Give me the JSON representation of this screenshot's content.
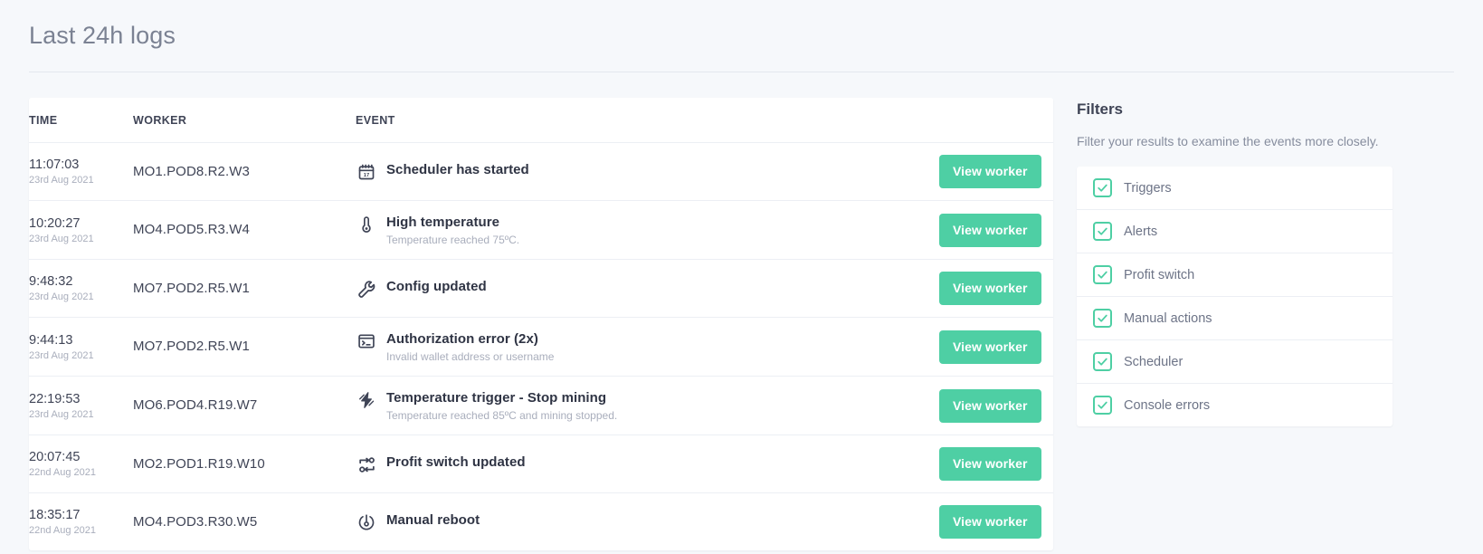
{
  "header": {
    "title": "Last 24h logs"
  },
  "table": {
    "columns": {
      "time": "TIME",
      "worker": "WORKER",
      "event": "EVENT",
      "action": ""
    },
    "action_label": "View worker",
    "rows": [
      {
        "time": "11:07:03",
        "date": "23rd Aug 2021",
        "worker": "MO1.POD8.R2.W3",
        "icon": "calendar-icon",
        "event_title": "Scheduler has started",
        "event_desc": ""
      },
      {
        "time": "10:20:27",
        "date": "23rd Aug 2021",
        "worker": "MO4.POD5.R3.W4",
        "icon": "thermometer-icon",
        "event_title": "High temperature",
        "event_desc": "Temperature reached 75ºC."
      },
      {
        "time": "9:48:32",
        "date": "23rd Aug 2021",
        "worker": "MO7.POD2.R5.W1",
        "icon": "wrench-icon",
        "event_title": "Config updated",
        "event_desc": ""
      },
      {
        "time": "9:44:13",
        "date": "23rd Aug 2021",
        "worker": "MO7.POD2.R5.W1",
        "icon": "terminal-icon",
        "event_title": "Authorization error (2x)",
        "event_desc": "Invalid wallet address or username"
      },
      {
        "time": "22:19:53",
        "date": "23rd Aug 2021",
        "worker": "MO6.POD4.R19.W7",
        "icon": "lightning-icon",
        "event_title": "Temperature trigger - Stop mining",
        "event_desc": "Temperature reached 85ºC and mining stopped."
      },
      {
        "time": "20:07:45",
        "date": "22nd Aug 2021",
        "worker": "MO2.POD1.R19.W10",
        "icon": "profit-switch-icon",
        "event_title": "Profit switch updated",
        "event_desc": ""
      },
      {
        "time": "18:35:17",
        "date": "22nd Aug 2021",
        "worker": "MO4.POD3.R30.W5",
        "icon": "power-reboot-icon",
        "event_title": "Manual reboot",
        "event_desc": ""
      }
    ]
  },
  "filters": {
    "title": "Filters",
    "description": "Filter your results to examine the events more closely.",
    "items": [
      {
        "label": "Triggers",
        "checked": true
      },
      {
        "label": "Alerts",
        "checked": true
      },
      {
        "label": "Profit switch",
        "checked": true
      },
      {
        "label": "Manual actions",
        "checked": true
      },
      {
        "label": "Scheduler",
        "checked": true
      },
      {
        "label": "Console errors",
        "checked": true
      }
    ]
  },
  "colors": {
    "accent": "#4ecfa4",
    "page_background": "#f6f8fb",
    "card_background": "#ffffff",
    "text": "#3f4456",
    "muted_text": "#a9aebc"
  }
}
